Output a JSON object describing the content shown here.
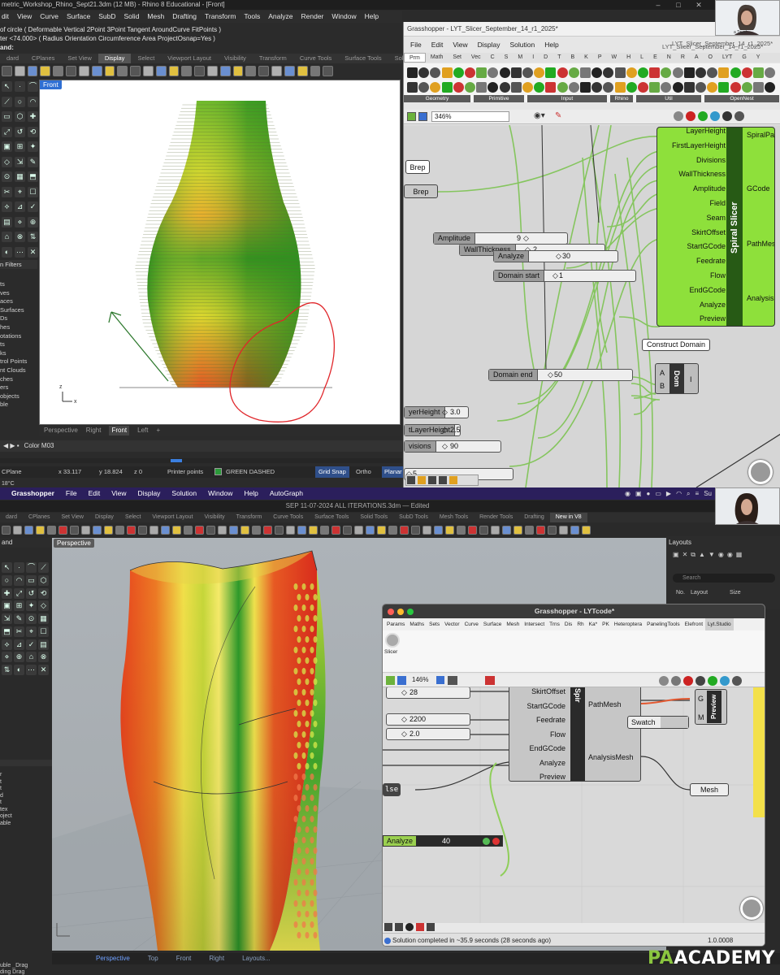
{
  "top": {
    "rhino_title": "metric_Workshop_Rhino_Sept21.3dm (12 MB) - Rhino 8 Educational - [Front]",
    "menu": [
      "dit",
      "View",
      "Curve",
      "Surface",
      "SubD",
      "Solid",
      "Mesh",
      "Drafting",
      "Transform",
      "Tools",
      "Analyze",
      "Render",
      "Window",
      "Help"
    ],
    "cmd_line1": "of circle ( Deformable  Vertical  2Point  3Point  Tangent  AroundCurve  FitPoints )",
    "cmd_line2": "ter <74.000> ( Radius  Orientation  Circumference  Area  ProjectOsnap=Yes )",
    "cmd_prompt": "and:",
    "toolbar_tabs": [
      "dard",
      "CPlanes",
      "Set View",
      "Display",
      "Select",
      "Viewport Layout",
      "Visibility",
      "Transform",
      "Curve Tools",
      "Surface Tools",
      "Solid Tools"
    ],
    "active_tab": "Display",
    "viewport_label": "Front",
    "axis_z": "z",
    "axis_x": "x",
    "sidebar_title": "n Filters",
    "sidebar_items": [
      "ts",
      "ves",
      "aces",
      "Surfaces",
      "Ds",
      "hes",
      "otations",
      "ts",
      "ks",
      "trol Points",
      "nt Clouds",
      "ches",
      "ers",
      "objects",
      "ble"
    ],
    "viewport_tabs": [
      "Perspective",
      "Right",
      "Front",
      "Left",
      "+"
    ],
    "active_viewport_tab": "Front",
    "layer": "Color M03",
    "status": {
      "cplane": "CPlane",
      "x": "x 33.117",
      "y": "y 18.824",
      "z": "z 0",
      "osnap": "Printer points",
      "layer_color_label": "GREEN DASHED",
      "grid_snap": "Grid Snap",
      "ortho": "Ortho",
      "planar": "Planar",
      "temp": "18°C"
    },
    "accent_green": "#8ee03b",
    "annotation_red": "#e0262a",
    "annotation_green": "#2f7a2f"
  },
  "gh_top": {
    "title": "Grasshopper - LYT_Slicer_September_14_r1_2025*",
    "title_right": "LYT_Slicer_September_14_r1_2025*",
    "menu": [
      "File",
      "Edit",
      "View",
      "Display",
      "Solution",
      "Help"
    ],
    "tabs": [
      "Prm",
      "Math",
      "Set",
      "Vec",
      "C",
      "S",
      "M",
      "I",
      "D",
      "T",
      "B",
      "K",
      "P",
      "W",
      "H",
      "L",
      "E",
      "N",
      "R",
      "A",
      "O",
      "LYT",
      "G",
      "Y"
    ],
    "groups": [
      "Geometry",
      "Primitive",
      "Input",
      "Rhino",
      "Util",
      "OpenNest"
    ],
    "zoom": "346%",
    "brep_label": "Brep",
    "brep_param": "Brep",
    "sliders": [
      {
        "name": "WallThickness",
        "value": "2"
      },
      {
        "name": "Amplitude",
        "value": "9"
      },
      {
        "name": "Analyze",
        "value": "30"
      },
      {
        "name": "Domain start",
        "value": "1"
      },
      {
        "name": "Domain end",
        "value": "50"
      },
      {
        "name": "yerHeight",
        "value": "3.0"
      },
      {
        "name": "tLayerHeight",
        "value": "2.5"
      },
      {
        "name": "visions",
        "value": "90"
      },
      {
        "name": "",
        "value": "5"
      }
    ],
    "slicer": {
      "name": "Spiral Slicer",
      "inputs": [
        "LayerHeight",
        "FirstLayerHeight",
        "Divisions",
        "WallThickness",
        "Amplitude",
        "Field",
        "Seam",
        "SkirtOffset",
        "StartGCode",
        "Feedrate",
        "Flow",
        "EndGCode",
        "Analyze",
        "Preview"
      ],
      "outputs": [
        "SpiralPat",
        "GCode",
        "PathMesh",
        "AnalysisM"
      ]
    },
    "construct_domain": {
      "label": "Construct Domain",
      "inputs": [
        "A",
        "B"
      ],
      "name": "Dom",
      "output": "I"
    },
    "webcam_label": "a Tayel"
  },
  "bottom": {
    "mac_menu": [
      "Grasshopper",
      "File",
      "Edit",
      "View",
      "Display",
      "Solution",
      "Window",
      "Help",
      "AutoGraph"
    ],
    "mac_clock": "Su",
    "doc_title": "SEP 11-07-2024 ALL ITERATIONS.3dm — Edited",
    "tabs": [
      "dard",
      "CPlanes",
      "Set View",
      "Display",
      "Select",
      "Viewport Layout",
      "Visibility",
      "Transform",
      "Curve Tools",
      "Surface Tools",
      "Solid Tools",
      "SubD Tools",
      "Mesh Tools",
      "Render Tools",
      "Drafting",
      "New in V8"
    ],
    "active_tab": "New in V8",
    "viewport_label": "Perspective",
    "viewport_tabs": [
      "Perspective",
      "Top",
      "Front",
      "Right",
      "Layouts..."
    ],
    "active_viewport_tab": "Perspective",
    "layouts_panel": {
      "title": "Layouts",
      "search": "Search",
      "col_no": "No.",
      "col_layout": "Layout",
      "col_size": "Size"
    },
    "sidebar_prompt": "and",
    "left_items": [
      "r",
      "t",
      "t",
      "d",
      "t",
      "tex",
      "oject",
      "able"
    ],
    "cmd_bottom1": "uble _Drag",
    "cmd_bottom2": "ding Drag",
    "logo": {
      "pa": "PA",
      "academy": "ACADEMY"
    }
  },
  "gh_bottom": {
    "title": "Grasshopper - LYTcode*",
    "tabs": [
      "Params",
      "Maths",
      "Sets",
      "Vector",
      "Curve",
      "Surface",
      "Mesh",
      "Intersect",
      "Trns",
      "Dis",
      "Rh",
      "Ka*",
      "PK",
      "Heteroptera",
      "PanelingTools",
      "Elefront",
      "Lyt.Studio"
    ],
    "active_tab": "Lyt.Studio",
    "slicer_button": "Slicer",
    "zoom": "146%",
    "sliders": [
      {
        "name": "",
        "value": "28"
      },
      {
        "name": "",
        "value": "2200"
      },
      {
        "name": "",
        "value": "2.0"
      }
    ],
    "analyze": {
      "name": "Analyze",
      "value": "40"
    },
    "toggle": "lse",
    "slicer_inputs": [
      "SkirtOffset",
      "StartGCode",
      "Feedrate",
      "Flow",
      "EndGCode",
      "Analyze",
      "Preview"
    ],
    "slicer_outputs": [
      "PathMesh",
      "AnalysisMesh"
    ],
    "slicer_name": "Spir",
    "swatch": "Swatch",
    "preview_inputs": [
      "G",
      "M"
    ],
    "preview_name": "Preview",
    "mesh": "Mesh",
    "status": "Solution completed in ~35.9 seconds (28 seconds ago)",
    "version": "1.0.0008"
  }
}
